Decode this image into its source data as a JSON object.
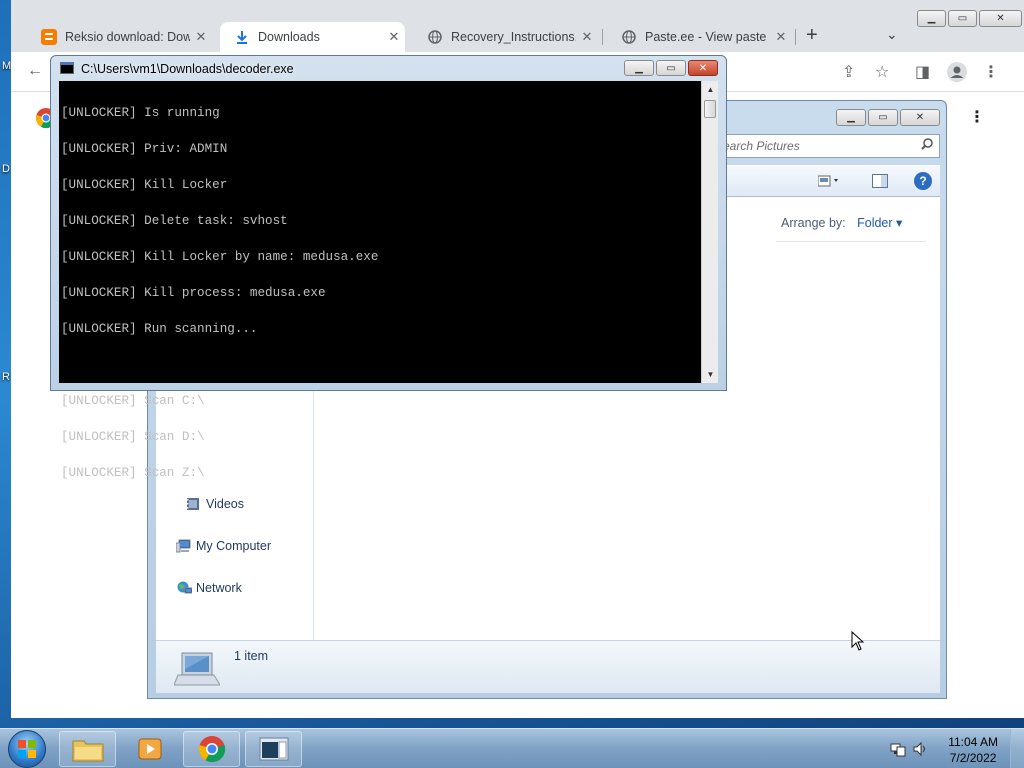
{
  "desktop": {
    "edge_labels": [
      "M",
      "D",
      "R"
    ]
  },
  "browser": {
    "tabs": [
      {
        "title": "Reksio download: Down",
        "icon": "blogger-icon",
        "color": "#f57d00"
      },
      {
        "title": "Downloads",
        "icon": "download-icon",
        "color": "#1a73e8"
      },
      {
        "title": "Recovery_Instructions.ht",
        "icon": "globe-icon",
        "color": "#5f6368"
      },
      {
        "title": "Paste.ee - View paste aB",
        "icon": "globe-icon",
        "color": "#5f6368"
      }
    ],
    "tab_close": "✕",
    "new_tab": "+",
    "tab_search": "⌄"
  },
  "explorer": {
    "search_placeholder": "Search Pictures",
    "arrange_label": "Arrange by:",
    "arrange_value": "Folder",
    "nav": {
      "videos": "Videos",
      "computer": "My Computer",
      "network": "Network"
    },
    "status_count": "1 item"
  },
  "console": {
    "title": "C:\\Users\\vm1\\Downloads\\decoder.exe",
    "lines": [
      "[UNLOCKER] Is running",
      "[UNLOCKER] Priv: ADMIN",
      "[UNLOCKER] Kill Locker",
      "[UNLOCKER] Delete task: svhost",
      "[UNLOCKER] Kill Locker by name: medusa.exe",
      "[UNLOCKER] Kill process: medusa.exe",
      "[UNLOCKER] Run scanning...",
      "",
      "[UNLOCKER] Scan C:\\",
      "[UNLOCKER] Scan D:\\",
      "[UNLOCKER] Scan Z:\\"
    ]
  },
  "taskbar": {
    "time": "11:04 AM",
    "date": "7/2/2022"
  }
}
